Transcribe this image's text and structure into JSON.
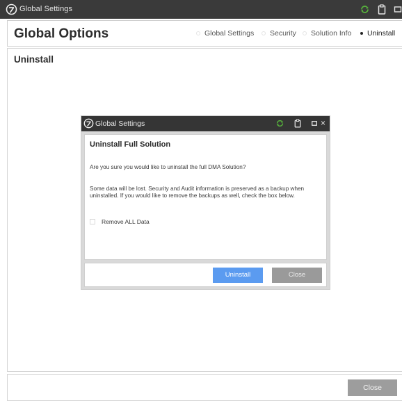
{
  "window": {
    "title": "Global Settings",
    "logo_icon": "dma-logo-icon",
    "controls": [
      "sync-icon",
      "clipboard-icon",
      "window-icon"
    ]
  },
  "header": {
    "title": "Global Options",
    "nav": [
      {
        "label": "Global Settings",
        "active": false
      },
      {
        "label": "Security",
        "active": false
      },
      {
        "label": "Solution Info",
        "active": false
      },
      {
        "label": "Uninstall",
        "active": true
      }
    ]
  },
  "main": {
    "section_title": "Uninstall"
  },
  "dialog": {
    "title": "Global Settings",
    "heading": "Uninstall Full Solution",
    "question": "Are you sure you would like to uninstall the full DMA Solution?",
    "warning": "Some data will be lost. Security and Audit information is preserved as a backup when uninstalled. If you would like to remove the backups as well, check the box below.",
    "checkbox_label": "Remove ALL Data",
    "checkbox_checked": false,
    "uninstall_label": "Uninstall",
    "close_label": "Close",
    "close_glyph": "×"
  },
  "footer": {
    "close_label": "Close"
  },
  "colors": {
    "titlebar": "#3a3a3a",
    "primary_button": "#5b9bf0",
    "secondary_button": "#9d9d9d",
    "sync_icon": "#57b23c"
  }
}
